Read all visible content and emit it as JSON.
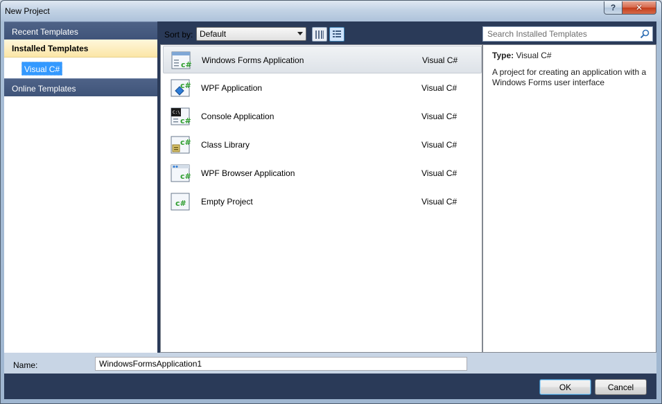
{
  "window": {
    "title": "New Project",
    "help_label": "?",
    "close_label": "✕"
  },
  "sidebar": {
    "recent": "Recent Templates",
    "installed": "Installed Templates",
    "installed_items": [
      {
        "label": "Visual C#",
        "selected": true
      }
    ],
    "online": "Online Templates"
  },
  "toolbar": {
    "sort_label": "Sort by:",
    "sort_value": "Default",
    "view_small_icon": "small-icons-view-icon",
    "view_details_icon": "details-view-icon"
  },
  "search": {
    "placeholder": "Search Installed Templates",
    "icon": "magnifier-icon"
  },
  "templates": [
    {
      "name": "Windows Forms Application",
      "lang": "Visual C#",
      "icon": "winforms-csharp-icon",
      "selected": true
    },
    {
      "name": "WPF Application",
      "lang": "Visual C#",
      "icon": "wpf-csharp-icon",
      "selected": false
    },
    {
      "name": "Console Application",
      "lang": "Visual C#",
      "icon": "console-csharp-icon",
      "selected": false
    },
    {
      "name": "Class Library",
      "lang": "Visual C#",
      "icon": "classlib-csharp-icon",
      "selected": false
    },
    {
      "name": "WPF Browser Application",
      "lang": "Visual C#",
      "icon": "wpf-browser-csharp-icon",
      "selected": false
    },
    {
      "name": "Empty Project",
      "lang": "Visual C#",
      "icon": "empty-project-csharp-icon",
      "selected": false
    }
  ],
  "details": {
    "type_label": "Type:",
    "type_value": "Visual C#",
    "description": "A project for creating an application with a Windows Forms user interface"
  },
  "name_row": {
    "label": "Name:",
    "value": "WindowsFormsApplication1"
  },
  "buttons": {
    "ok": "OK",
    "cancel": "Cancel"
  },
  "colors": {
    "accent": "#3399ff",
    "nav_header": "#4e6287",
    "installed_highlight": "#fbe6a7",
    "csharp_green": "#2f9e2f"
  }
}
